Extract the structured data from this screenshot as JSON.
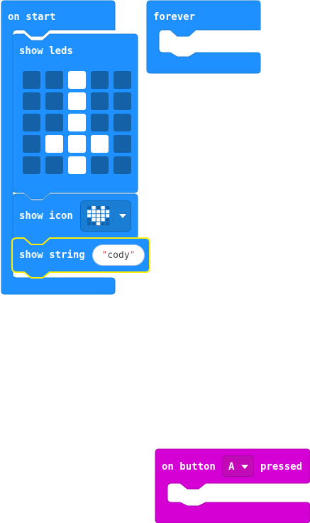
{
  "blocks": {
    "on_start": {
      "label": "on start"
    },
    "forever": {
      "label": "forever"
    },
    "show_leds": {
      "label": "show leds",
      "leds": [
        [
          0,
          0,
          1,
          0,
          0
        ],
        [
          0,
          0,
          1,
          0,
          0
        ],
        [
          0,
          0,
          1,
          0,
          0
        ],
        [
          0,
          1,
          1,
          1,
          0
        ],
        [
          0,
          0,
          1,
          0,
          0
        ]
      ]
    },
    "show_icon": {
      "label": "show icon",
      "icon": "heart-icon"
    },
    "show_string": {
      "label": "show string",
      "value": "cody",
      "quote_open": "\"",
      "quote_close": "\""
    },
    "on_button_pressed": {
      "label_prefix": "on button",
      "button": "A",
      "label_suffix": "pressed"
    }
  },
  "colors": {
    "basic_blue": "#1e90ff",
    "basic_blue_dark": "#1a7fd4",
    "led_off": "#1461a8",
    "input_magenta": "#d400d4",
    "selection_yellow": "#ffee00"
  }
}
